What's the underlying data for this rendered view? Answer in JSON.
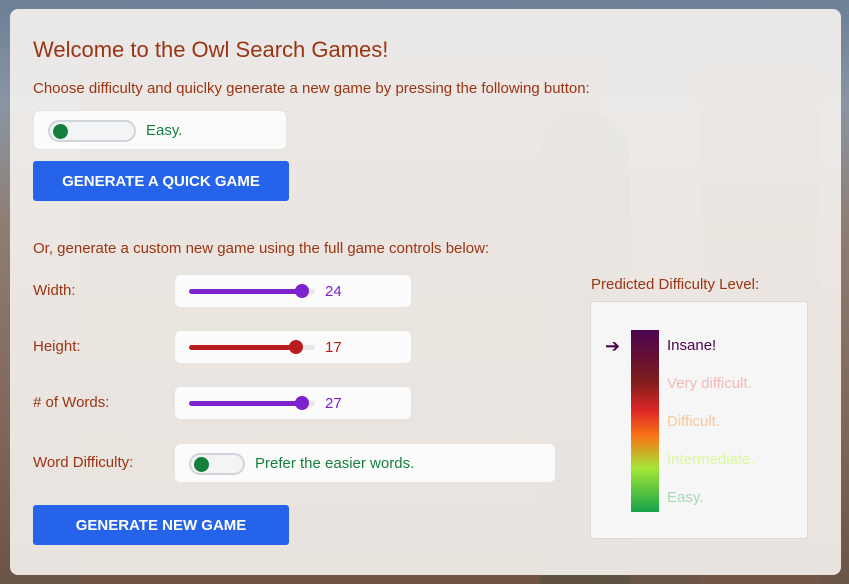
{
  "title": "Welcome to the Owl Search Games!",
  "quick": {
    "instruction": "Choose difficulty and quiclky generate a new game by pressing the following button:",
    "difficulty_label": "Easy.",
    "button_label": "GENERATE A QUICK GAME"
  },
  "custom": {
    "instruction": "Or, generate a custom new game using the full game controls below:",
    "width": {
      "label": "Width:",
      "value": "24",
      "fraction": 0.9,
      "color": "#7e22ce"
    },
    "height": {
      "label": "Height:",
      "value": "17",
      "fraction": 0.85,
      "color": "#b91c1c"
    },
    "words": {
      "label": "# of Words:",
      "value": "27",
      "fraction": 0.9,
      "color": "#7e22ce"
    },
    "word_difficulty": {
      "label": "Word Difficulty:",
      "toggle_label": "Prefer the easier words."
    },
    "button_label": "GENERATE NEW GAME"
  },
  "prediction": {
    "label": "Predicted Difficulty Level:",
    "current": "Insane!",
    "levels": [
      {
        "label": "Insane!",
        "color": "#4a044e"
      },
      {
        "label": "Very difficult.",
        "color": "#f2b8b8"
      },
      {
        "label": "Difficult.",
        "color": "#f9c79a"
      },
      {
        "label": "Intermediate.",
        "color": "#d9f99d"
      },
      {
        "label": "Easy.",
        "color": "#a7d9b5"
      }
    ]
  },
  "colors": {
    "heading": "#9a3412",
    "accent_button": "#2563eb",
    "toggle_on": "#15803d"
  }
}
